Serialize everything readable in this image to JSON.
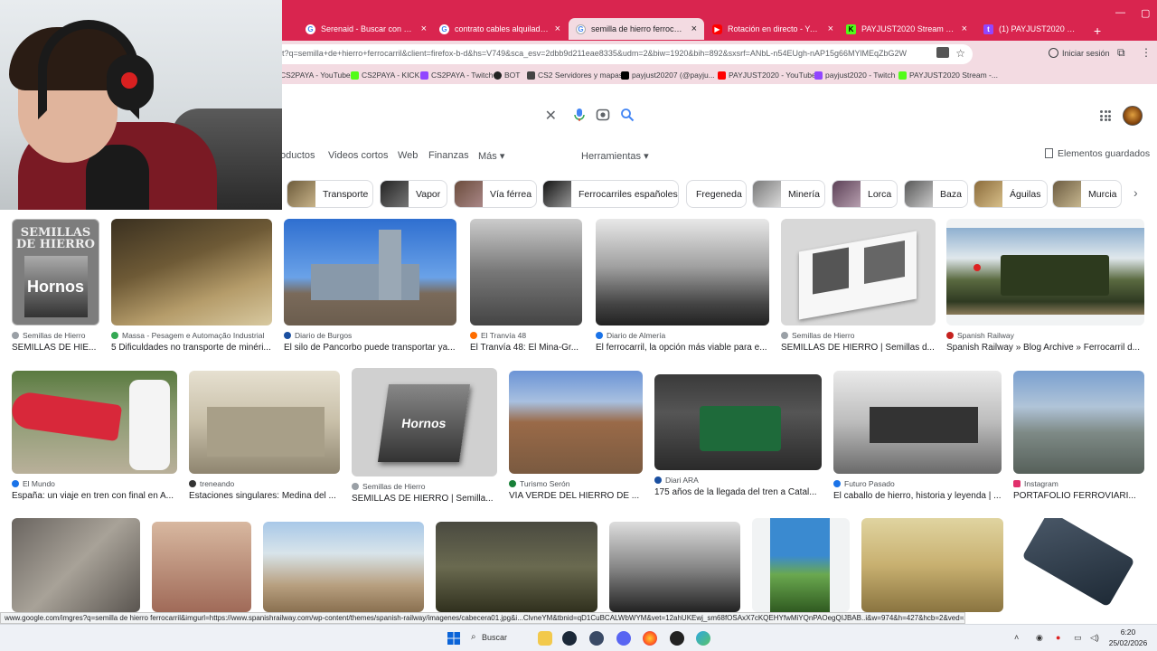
{
  "browser": {
    "tabs": [
      {
        "title": "Serenaid - Buscar con Google",
        "color": "#fff",
        "icon": "google-icon"
      },
      {
        "title": "contrato cables alquiladores -",
        "color": "#fff",
        "icon": "google-icon"
      },
      {
        "title": "semilla de hierro ferrocarril - B",
        "color": "#fff",
        "icon": "google-icon",
        "active": true
      },
      {
        "title": "Rotación en directo - YouTube",
        "color": "#ff0000",
        "icon": "youtube-icon"
      },
      {
        "title": "PAYJUST2020 Stream - Watch",
        "color": "#53fc18",
        "icon": "kick-icon"
      },
      {
        "title": "(1) PAYJUST2020 - Twitch",
        "color": "#9146ff",
        "icon": "twitch-icon"
      }
    ],
    "url": "t?q=semilla+de+hierro+ferrocarril&client=firefox-b-d&hs=V749&sca_esv=2dbb9d211eae8335&udm=2&biw=1920&bih=892&sxsrf=ANbL-n54EUgh-nAP15g66MYlMEqZbG2W",
    "signin_label": "Iniciar sesión",
    "bookmarks": [
      {
        "label": "CS2PAYA - YouTube",
        "color": "#ff0000"
      },
      {
        "label": "CS2PAYA - KICK",
        "color": "#53fc18"
      },
      {
        "label": "CS2PAYA - Twitch",
        "color": "#9146ff"
      },
      {
        "label": "BOT",
        "color": "#222"
      },
      {
        "label": "CS2 Servidores y mapas",
        "color": "#444"
      },
      {
        "label": "payjust20207 (@payju...",
        "color": "#000"
      },
      {
        "label": "PAYJUST2020 - YouTube",
        "color": "#ff0000"
      },
      {
        "label": "payjust2020 - Twitch",
        "color": "#9146ff"
      },
      {
        "label": "PAYJUST2020 Stream -...",
        "color": "#53fc18"
      }
    ]
  },
  "google": {
    "filters": [
      {
        "label": "oductos"
      },
      {
        "label": "Videos cortos"
      },
      {
        "label": "Web"
      },
      {
        "label": "Finanzas"
      },
      {
        "label": "Más ▾"
      },
      {
        "label": "Herramientas ▾"
      }
    ],
    "saved_label": "Elementos guardados",
    "chips": [
      "Transporte",
      "Vapor",
      "Vía férrea",
      "Ferrocarriles españoles",
      "Fregeneda",
      "Minería",
      "Lorca",
      "Baza",
      "Águilas",
      "Murcia"
    ],
    "results": [
      {
        "source": "Semillas de Hierro",
        "title": "SEMILLAS DE HIE...",
        "color": "#9aa0a6"
      },
      {
        "source": "Massa - Pesagem e Automação Industrial",
        "title": "5 Dificuldades no transporte de minéri...",
        "color": "#34a853"
      },
      {
        "source": "Diario de Burgos",
        "title": "El silo de Pancorbo puede transportar ya...",
        "color": "#1a4fa0"
      },
      {
        "source": "El Tranvía 48",
        "title": "El Tranvía 48: El Mina-Gr...",
        "color": "#ff6d00"
      },
      {
        "source": "Diario de Almería",
        "title": "El ferrocarril, la opción más viable para e...",
        "color": "#1a73e8"
      },
      {
        "source": "Semillas de Hierro",
        "title": "SEMILLAS DE HIERRO | Semillas d...",
        "color": "#9aa0a6"
      },
      {
        "source": "Spanish Railway",
        "title": "Spanish Railway » Blog Archive » Ferrocarril d...",
        "color": "#c5221f"
      },
      {
        "source": "El Mundo",
        "title": "España: un viaje en tren con final en A...",
        "color": "#1a73e8"
      },
      {
        "source": "treneando",
        "title": "Estaciones singulares: Medina del ...",
        "color": "#333"
      },
      {
        "source": "Semillas de Hierro",
        "title": "SEMILLAS DE HIERRO | Semilla...",
        "color": "#9aa0a6"
      },
      {
        "source": "Turismo Serón",
        "title": "VÍA VERDE DEL HIERRO DE ...",
        "color": "#188038"
      },
      {
        "source": "Diari ARA",
        "title": "175 años de la llegada del tren a Catal...",
        "color": "#1a4fa0"
      },
      {
        "source": "Futuro Pasado",
        "title": "El caballo de hierro, historia y leyenda | ...",
        "color": "#1a73e8"
      },
      {
        "source": "Instagram",
        "title": "PORTAFOLIO FERROVIARI...",
        "color": "#e1306c"
      }
    ]
  },
  "status_url": "www.google.com/imgres?q=semilla de hierro ferrocarril&imgurl=https://www.spanishrailway.com/wp-content/themes/spanish-railway/imagenes/cabecera01.jpg&i...ClvneYM&tbnid=qD1CuBCALWbWYM&vet=12ahUKEwj_sm68fOSAxX7cKQEHYfwMiYQnPAOegQIJBAB..i&w=974&h=427&hcb=2&ved=2ahUKEwj_sm68fOSAxX7cKQEHYfwMiYQnPAOegQIJBAB",
  "taskbar": {
    "search_label": "Buscar",
    "time": "6:20",
    "date": "25/02/2026"
  }
}
